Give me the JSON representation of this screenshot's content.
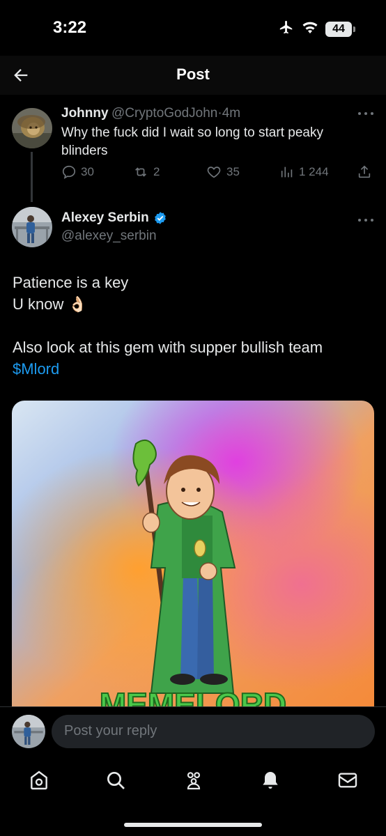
{
  "status_bar": {
    "time": "3:22",
    "battery": "44"
  },
  "header": {
    "title": "Post"
  },
  "parent_post": {
    "name": "Johnny",
    "handle": "@CryptoGodJohn",
    "separator": "·",
    "time": "4m",
    "text": "Why the fuck did I wait so long to start peaky blinders",
    "replies": "30",
    "reposts": "2",
    "likes": "35",
    "views": "1 244"
  },
  "main_post": {
    "name": "Alexey Serbin",
    "handle": "@alexey_serbin",
    "lines": [
      "Patience is a key",
      "U know 👌🏻",
      "",
      "Also look at this gem with supper bullish team"
    ],
    "cashtag": "$Mlord",
    "media_caption": "MEMELORD"
  },
  "reply": {
    "placeholder": "Post your reply"
  },
  "colors": {
    "accent": "#1d9bf0",
    "background": "#000000",
    "muted": "#71767b"
  },
  "nav": [
    "home-icon",
    "search-icon",
    "communities-icon",
    "notifications-icon",
    "messages-icon"
  ]
}
